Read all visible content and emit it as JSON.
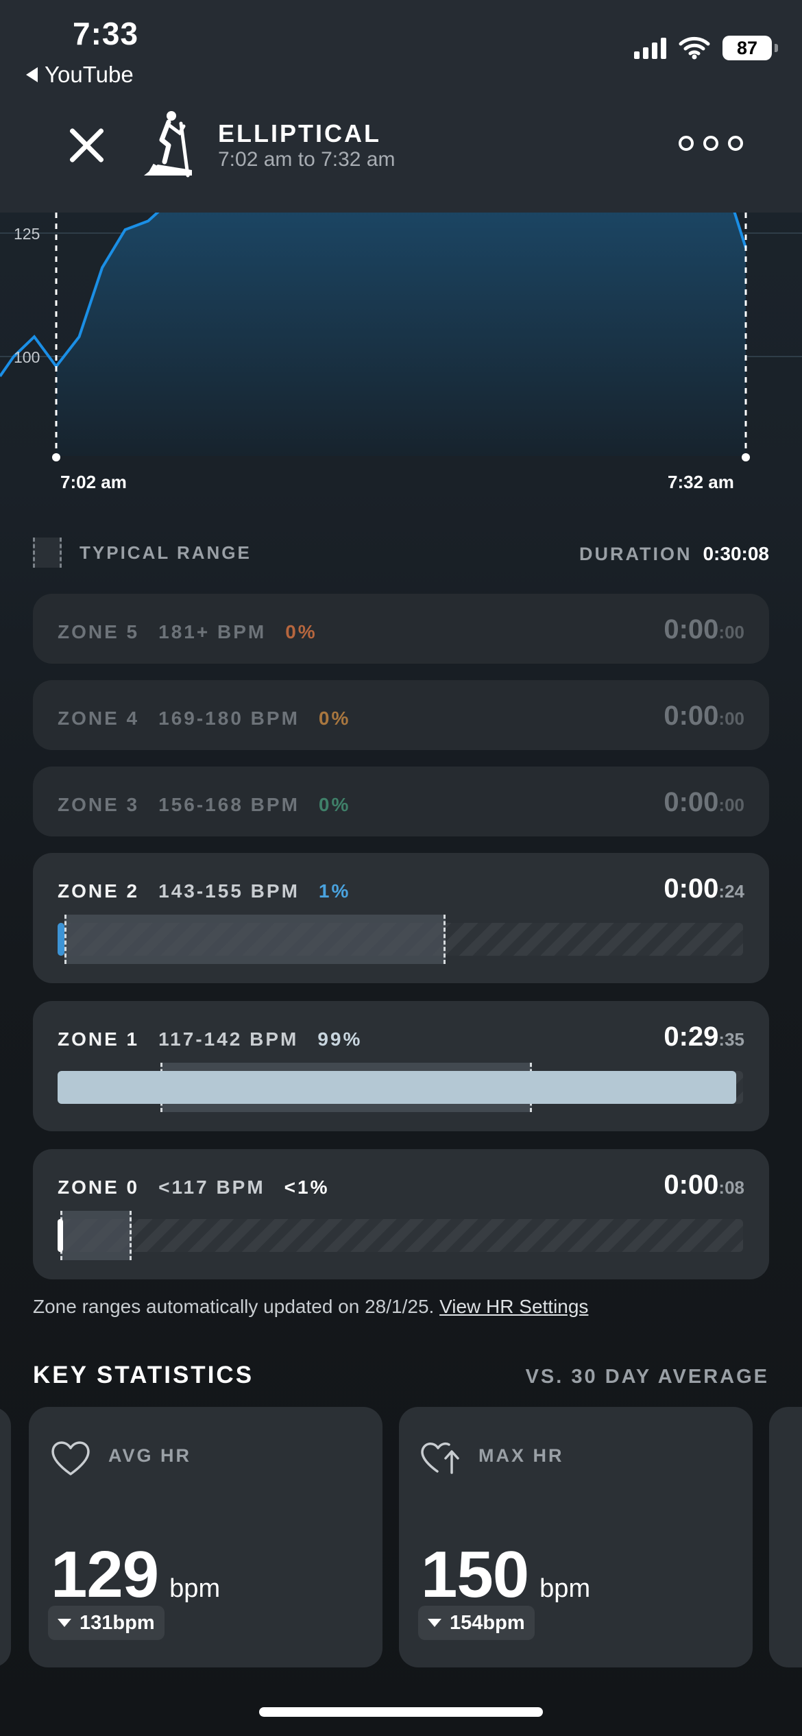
{
  "status_bar": {
    "time": "7:33",
    "back_app": "YouTube",
    "battery": "87"
  },
  "header": {
    "title": "ELLIPTICAL",
    "time_range": "7:02 am to 7:32 am"
  },
  "chart": {
    "y_ticks": [
      "125",
      "100"
    ],
    "x_start": "7:02 am",
    "x_end": "7:32 am"
  },
  "chart_data": {
    "type": "area",
    "x": [
      0,
      1,
      2,
      3,
      4,
      5,
      6,
      7,
      8,
      9,
      10,
      11,
      12,
      13,
      14,
      15,
      16,
      17,
      18,
      19,
      20,
      21,
      22,
      23,
      24,
      25,
      26,
      27,
      28,
      29,
      30
    ],
    "values": [
      98,
      104,
      118,
      125,
      128,
      131,
      133,
      134,
      135,
      135,
      136,
      136,
      136,
      136,
      136,
      136,
      136,
      136,
      136,
      136,
      136,
      136,
      136,
      136,
      136,
      136,
      136,
      136,
      136,
      136,
      122
    ],
    "y_ticks": [
      125,
      100
    ],
    "x_labels": [
      "7:02 am",
      "7:32 am"
    ]
  },
  "zones_header": {
    "legend_label": "TYPICAL RANGE",
    "duration_label": "DURATION",
    "duration_value": "0:30:08"
  },
  "zones": [
    {
      "name": "ZONE 5",
      "bpm": "181+ BPM",
      "pct": "0%",
      "pct_color": "#b6663e",
      "time_main": "0:00",
      "time_sec": ":00",
      "active": false
    },
    {
      "name": "ZONE 4",
      "bpm": "169-180 BPM",
      "pct": "0%",
      "pct_color": "#a9773f",
      "time_main": "0:00",
      "time_sec": ":00",
      "active": false
    },
    {
      "name": "ZONE 3",
      "bpm": "156-168 BPM",
      "pct": "0%",
      "pct_color": "#3f8069",
      "time_main": "0:00",
      "time_sec": ":00",
      "active": false
    },
    {
      "name": "ZONE 2",
      "bpm": "143-155 BPM",
      "pct": "1%",
      "pct_color": "#4aa3df",
      "time_main": "0:00",
      "time_sec": ":24",
      "active": true,
      "fill": 0.01,
      "fill_color": "#3d94d6"
    },
    {
      "name": "ZONE 1",
      "bpm": "117-142 BPM",
      "pct": "99%",
      "pct_color": "#c9d6df",
      "time_main": "0:29",
      "time_sec": ":35",
      "active": true,
      "fill": 0.99,
      "fill_color": "#b4c8d4"
    },
    {
      "name": "ZONE 0",
      "bpm": "<117 BPM",
      "pct": "<1%",
      "pct_color": "#ffffff",
      "time_main": "0:00",
      "time_sec": ":08",
      "active": true,
      "fill": 0.004,
      "fill_color": "#ffffff"
    }
  ],
  "note": {
    "text": "Zone ranges automatically updated on 28/1/25.",
    "link": "View HR Settings"
  },
  "key_statistics": {
    "title": "KEY STATISTICS",
    "subtitle": "VS. 30 DAY AVERAGE",
    "cards": [
      {
        "label": "AVG HR",
        "value": "129",
        "unit": "bpm",
        "compare": "131bpm",
        "icon": "heart-icon"
      },
      {
        "label": "MAX HR",
        "value": "150",
        "unit": "bpm",
        "compare": "154bpm",
        "icon": "heart-up-arrow-icon"
      }
    ]
  }
}
